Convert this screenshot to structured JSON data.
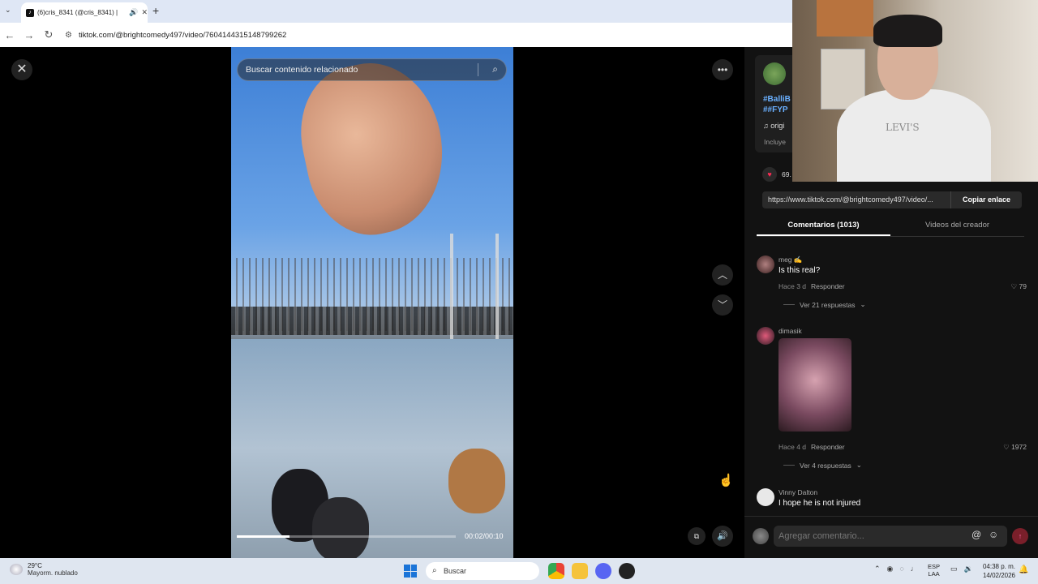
{
  "browser": {
    "tab_title": "(6)cris_8341 (@cris_8341) |",
    "url": "tiktok.com/@brightcomedy497/video/7604144315148799262"
  },
  "video": {
    "search_placeholder": "Buscar contenido relacionado",
    "timecode": "00:02/00:10",
    "progress_fraction": 0.24
  },
  "panel": {
    "hashtags_line1": "#BalliB",
    "hashtags_line2": "##FYP",
    "sound": "origi",
    "includes": "Incluye",
    "like_count": "69.",
    "link_url": "https://www.tiktok.com/@brightcomedy497/video/...",
    "copy_label": "Copiar enlace",
    "tabs": [
      {
        "label": "Comentarios (1013)"
      },
      {
        "label": "Videos del creador"
      }
    ],
    "comments": [
      {
        "user": "meg ✍",
        "text": "Is this real?",
        "time": "Hace 3 d",
        "reply": "Responder",
        "likes": "79",
        "more": "Ver 21 respuestas"
      },
      {
        "user": "dimasik",
        "text": "",
        "time": "Hace 4 d",
        "reply": "Responder",
        "likes": "1972",
        "more": "Ver 4 respuestas"
      },
      {
        "user": "Vinny Dalton",
        "text": "I hope he is not injured"
      }
    ],
    "compose_placeholder": "Agregar comentario..."
  },
  "webcam": {
    "shirt_text": "LEVI'S"
  },
  "taskbar": {
    "temp": "29°C",
    "weather": "Mayorm. nublado",
    "search": "Buscar",
    "lang1": "ESP",
    "lang2": "LAA",
    "time": "04:38 p. m.",
    "date": "14/02/2026"
  },
  "colors": {
    "accent_like": "#ff2c55",
    "hashtag": "#6ab0ff",
    "panel_bg": "#121212"
  }
}
